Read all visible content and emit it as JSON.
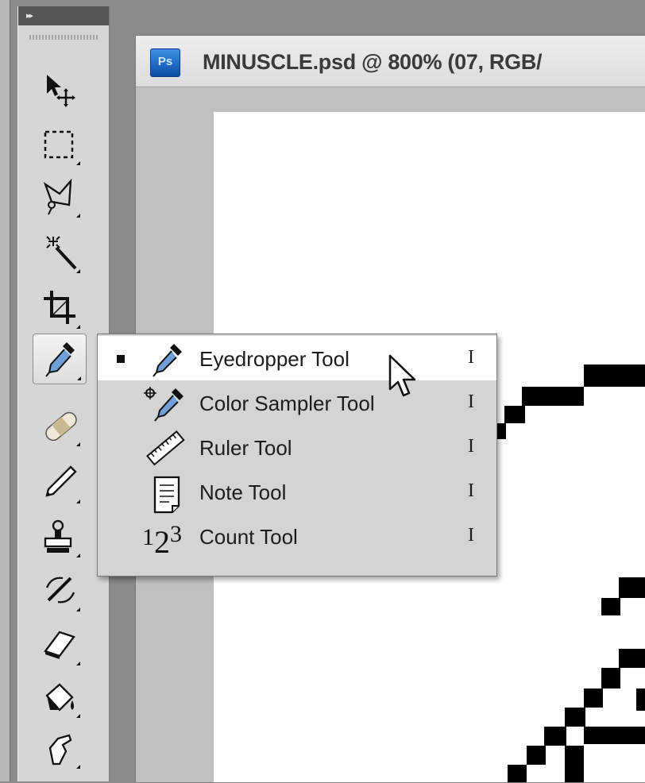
{
  "document": {
    "title": "MINUSCLE.psd @ 800% (07, RGB/",
    "app_badge": "Ps"
  },
  "toolbar": {
    "collapse_label": "▸▸",
    "tools": [
      {
        "name": "move-tool",
        "icon": "move-icon"
      },
      {
        "name": "marquee-tool",
        "icon": "rect-marquee-icon"
      },
      {
        "name": "lasso-tool",
        "icon": "polygonal-lasso-icon"
      },
      {
        "name": "magic-wand-tool",
        "icon": "magic-wand-icon"
      },
      {
        "name": "crop-tool",
        "icon": "crop-icon"
      },
      {
        "name": "eyedropper-tool",
        "icon": "eyedropper-icon",
        "active": true
      },
      {
        "name": "healing-brush-tool",
        "icon": "bandage-icon"
      },
      {
        "name": "brush-tool",
        "icon": "pencil-icon"
      },
      {
        "name": "clone-stamp-tool",
        "icon": "stamp-icon"
      },
      {
        "name": "history-brush-tool",
        "icon": "history-brush-icon"
      },
      {
        "name": "eraser-tool",
        "icon": "eraser-icon"
      },
      {
        "name": "paint-bucket-tool",
        "icon": "bucket-icon"
      },
      {
        "name": "smudge-tool",
        "icon": "smudge-finger-icon"
      }
    ]
  },
  "flyout_menu": {
    "items": [
      {
        "label": "Eyedropper Tool",
        "shortcut": "I",
        "icon": "eyedropper-icon",
        "selected": true,
        "hovered": true
      },
      {
        "label": "Color Sampler Tool",
        "shortcut": "I",
        "icon": "color-sampler-icon",
        "selected": false
      },
      {
        "label": "Ruler Tool",
        "shortcut": "I",
        "icon": "ruler-icon",
        "selected": false
      },
      {
        "label": "Note Tool",
        "shortcut": "I",
        "icon": "note-icon",
        "selected": false
      },
      {
        "label": "Count Tool",
        "shortcut": "I",
        "icon": "count-icon",
        "selected": false
      }
    ],
    "count_icon_digits": {
      "one": "1",
      "two": "2",
      "three": "3"
    }
  },
  "colors": {
    "toolbar_bg": "#d6d6d6",
    "menu_bg": "#d4d4d4",
    "menu_highlight": "#ffffff",
    "badge_blue": "#1f6fd0"
  }
}
